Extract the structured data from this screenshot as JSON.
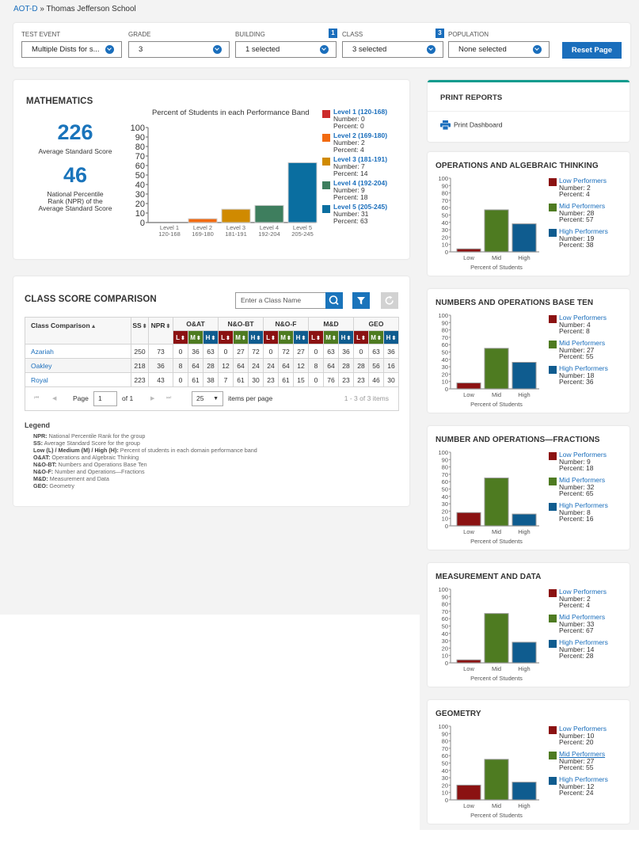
{
  "breadcrumb": {
    "link": "AOT-D",
    "separator": "»",
    "current": "Thomas Jefferson School"
  },
  "filters": [
    {
      "label": "TEST EVENT",
      "value": "Multiple Dists for s...",
      "badge": null
    },
    {
      "label": "GRADE",
      "value": "3",
      "badge": null
    },
    {
      "label": "BUILDING",
      "value": "1 selected",
      "badge": "1"
    },
    {
      "label": "CLASS",
      "value": "3 selected",
      "badge": "3"
    },
    {
      "label": "POPULATION",
      "value": "None selected",
      "badge": null
    }
  ],
  "reset_label": "Reset Page",
  "math": {
    "title": "MATHEMATICS",
    "avg_score": "226",
    "avg_score_caption": "Average Standard Score",
    "npr": "46",
    "npr_caption_1": "National Percentile",
    "npr_caption_2": "Rank (NPR) of the",
    "npr_caption_3": "Average Standard Score",
    "chart_title": "Percent of Students in each Performance Band",
    "legend": [
      {
        "title": "Level 1 (120-168)",
        "number": "Number: 0",
        "percent": "Percent: 0",
        "color": "#cc2a2a"
      },
      {
        "title": "Level 2 (169-180)",
        "number": "Number: 2",
        "percent": "Percent: 4",
        "color": "#f26a10"
      },
      {
        "title": "Level 3 (181-191)",
        "number": "Number: 7",
        "percent": "Percent: 14",
        "color": "#d08a00"
      },
      {
        "title": "Level 4 (192-204)",
        "number": "Number: 9",
        "percent": "Percent: 18",
        "color": "#3e7e5e"
      },
      {
        "title": "Level 5 (205-245)",
        "number": "Number: 31",
        "percent": "Percent: 63",
        "color": "#0a6ea0"
      }
    ]
  },
  "chart_data": [
    {
      "type": "bar",
      "title": "Percent of Students in each Performance Band",
      "categories": [
        "Level 1\n120-168",
        "Level 2\n169-180",
        "Level 3\n181-191",
        "Level 4\n192-204",
        "Level 5\n205-245"
      ],
      "cat_line1": [
        "Level 1",
        "Level 2",
        "Level 3",
        "Level 4",
        "Level 5"
      ],
      "cat_line2": [
        "120-168",
        "169-180",
        "181-191",
        "192-204",
        "205-245"
      ],
      "values": [
        0,
        4,
        14,
        18,
        63
      ],
      "colors": [
        "#cc2a2a",
        "#f26a10",
        "#d08a00",
        "#3e7e5e",
        "#0a6ea0"
      ],
      "ylim": [
        0,
        100
      ],
      "yticks": [
        0,
        10,
        20,
        30,
        40,
        50,
        60,
        70,
        80,
        90,
        100
      ],
      "xlabel": "",
      "ylabel": ""
    },
    {
      "type": "bar",
      "title": "OPERATIONS AND ALGEBRAIC THINKING",
      "categories": [
        "Low",
        "Mid",
        "High"
      ],
      "values": [
        4,
        57,
        38
      ],
      "xlabel": "Percent of Students",
      "ylim": [
        0,
        100
      ]
    },
    {
      "type": "bar",
      "title": "NUMBERS AND OPERATIONS BASE TEN",
      "categories": [
        "Low",
        "Mid",
        "High"
      ],
      "values": [
        8,
        55,
        36
      ],
      "xlabel": "Percent of Students",
      "ylim": [
        0,
        100
      ]
    },
    {
      "type": "bar",
      "title": "NUMBER AND OPERATIONS—FRACTIONS",
      "categories": [
        "Low",
        "Mid",
        "High"
      ],
      "values": [
        18,
        65,
        16
      ],
      "xlabel": "Percent of Students",
      "ylim": [
        0,
        100
      ]
    },
    {
      "type": "bar",
      "title": "MEASUREMENT AND DATA",
      "categories": [
        "Low",
        "Mid",
        "High"
      ],
      "values": [
        4,
        67,
        28
      ],
      "xlabel": "Percent of Students",
      "ylim": [
        0,
        100
      ]
    },
    {
      "type": "bar",
      "title": "GEOMETRY",
      "categories": [
        "Low",
        "Mid",
        "High"
      ],
      "values": [
        20,
        55,
        24
      ],
      "xlabel": "Percent of Students",
      "ylim": [
        0,
        100
      ]
    }
  ],
  "csc": {
    "title": "CLASS SCORE COMPARISON",
    "search_placeholder": "Enter a Class Name",
    "headers": {
      "name": "Class Comparison",
      "ss": "SS",
      "npr": "NPR"
    },
    "groups": [
      "O&AT",
      "N&O-BT",
      "N&O-F",
      "M&D",
      "GEO"
    ],
    "subs": [
      "L",
      "M",
      "H"
    ],
    "rows": [
      {
        "name": "Azariah",
        "ss": "250",
        "npr": "73",
        "vals": [
          "0",
          "36",
          "63",
          "0",
          "27",
          "72",
          "0",
          "72",
          "27",
          "0",
          "63",
          "36",
          "0",
          "63",
          "36"
        ]
      },
      {
        "name": "Oakley",
        "ss": "218",
        "npr": "36",
        "vals": [
          "8",
          "64",
          "28",
          "12",
          "64",
          "24",
          "24",
          "64",
          "12",
          "8",
          "64",
          "28",
          "28",
          "56",
          "16"
        ]
      },
      {
        "name": "Royal",
        "ss": "223",
        "npr": "43",
        "vals": [
          "0",
          "61",
          "38",
          "7",
          "61",
          "30",
          "23",
          "61",
          "15",
          "0",
          "76",
          "23",
          "23",
          "46",
          "30"
        ]
      }
    ],
    "pager": {
      "page_label": "Page",
      "page": "1",
      "of": "of 1",
      "per_page": "25",
      "per_page_label": "items per page",
      "summary": "1 - 3 of 3 items"
    },
    "legend_title": "Legend",
    "legend": [
      {
        "k": "NPR:",
        "v": " National Percentile Rank for the group"
      },
      {
        "k": "SS:",
        "v": " Average Standard Score for the group"
      },
      {
        "k": "Low (L) / Medium (M) / High (H):",
        "v": " Percent of students in each domain performance band"
      },
      {
        "k": "O&AT:",
        "v": " Operations and Algebraic Thinking"
      },
      {
        "k": "N&O-BT:",
        "v": " Numbers and Operations Base Ten"
      },
      {
        "k": "N&O-F:",
        "v": " Number and Operations—Fractions"
      },
      {
        "k": "M&D:",
        "v": " Measurement and Data"
      },
      {
        "k": "GEO:",
        "v": " Geometry"
      }
    ]
  },
  "print": {
    "title": "PRINT REPORTS",
    "link": "Print Dashboard"
  },
  "domain_colors": {
    "low": "#8b1212",
    "mid": "#4e7b21",
    "high": "#0f5c8f"
  },
  "domains": [
    {
      "title": "OPERATIONS AND ALGEBRAIC THINKING",
      "legend": [
        {
          "title": "Low Performers",
          "number": "Number: 2",
          "percent": "Percent: 4"
        },
        {
          "title": "Mid Performers",
          "number": "Number: 28",
          "percent": "Percent: 57"
        },
        {
          "title": "High Performers",
          "number": "Number: 19",
          "percent": "Percent: 38"
        }
      ]
    },
    {
      "title": "NUMBERS AND OPERATIONS BASE TEN",
      "legend": [
        {
          "title": "Low Performers",
          "number": "Number: 4",
          "percent": "Percent: 8"
        },
        {
          "title": "Mid Performers",
          "number": "Number: 27",
          "percent": "Percent: 55"
        },
        {
          "title": "High Performers",
          "number": "Number: 18",
          "percent": "Percent: 36"
        }
      ]
    },
    {
      "title": "NUMBER AND OPERATIONS—FRACTIONS",
      "legend": [
        {
          "title": "Low Performers",
          "number": "Number: 9",
          "percent": "Percent: 18"
        },
        {
          "title": "Mid Performers",
          "number": "Number: 32",
          "percent": "Percent: 65"
        },
        {
          "title": "High Performers",
          "number": "Number: 8",
          "percent": "Percent: 16"
        }
      ]
    },
    {
      "title": "MEASUREMENT AND DATA",
      "legend": [
        {
          "title": "Low Performers",
          "number": "Number: 2",
          "percent": "Percent: 4"
        },
        {
          "title": "Mid Performers",
          "number": "Number: 33",
          "percent": "Percent: 67"
        },
        {
          "title": "High Performers",
          "number": "Number: 14",
          "percent": "Percent: 28"
        }
      ]
    },
    {
      "title": "GEOMETRY",
      "legend": [
        {
          "title": "Low Performers",
          "number": "Number: 10",
          "percent": "Percent: 20"
        },
        {
          "title": "Mid Performers",
          "number": "Number: 27",
          "percent": "Percent: 55"
        },
        {
          "title": "High Performers",
          "number": "Number: 12",
          "percent": "Percent: 24"
        }
      ]
    }
  ]
}
